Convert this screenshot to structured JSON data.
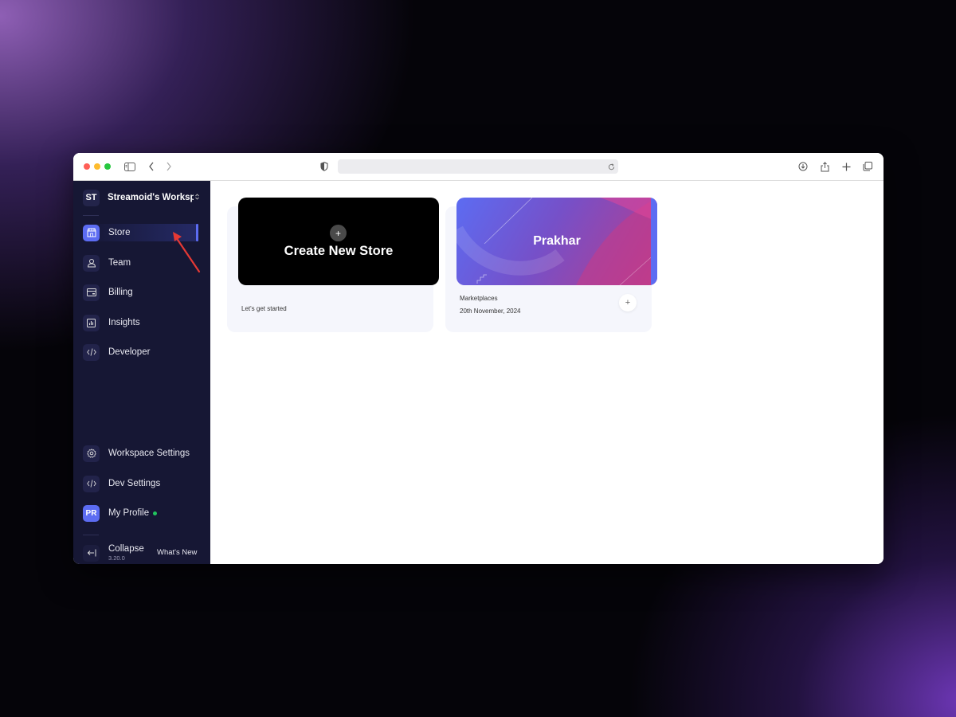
{
  "browser": {
    "address": ""
  },
  "sidebar": {
    "workspace": {
      "initials": "ST",
      "name": "Streamoid's Worksp..."
    },
    "nav": [
      {
        "label": "Store",
        "icon": "store-icon",
        "active": true
      },
      {
        "label": "Team",
        "icon": "team-icon",
        "active": false
      },
      {
        "label": "Billing",
        "icon": "billing-icon",
        "active": false
      },
      {
        "label": "Insights",
        "icon": "insights-icon",
        "active": false
      },
      {
        "label": "Developer",
        "icon": "code-icon",
        "active": false
      }
    ],
    "bottom": [
      {
        "label": "Workspace Settings",
        "icon": "gear-icon"
      },
      {
        "label": "Dev Settings",
        "icon": "code-icon"
      }
    ],
    "profile": {
      "initials": "PR",
      "label": "My Profile",
      "online": true
    },
    "collapse": {
      "label": "Collapse",
      "version": "3.20.0",
      "whats_new": "What's New"
    }
  },
  "main": {
    "create_card": {
      "title": "Create New Store",
      "subtitle": "Let's get started"
    },
    "store_card": {
      "name": "Prakhar",
      "category": "Marketplaces",
      "date": "20th November, 2024"
    }
  },
  "colors": {
    "sidebar_bg": "#161734",
    "accent": "#5c6cf2",
    "annotation_arrow": "#e53935",
    "status_online": "#22c55e"
  }
}
